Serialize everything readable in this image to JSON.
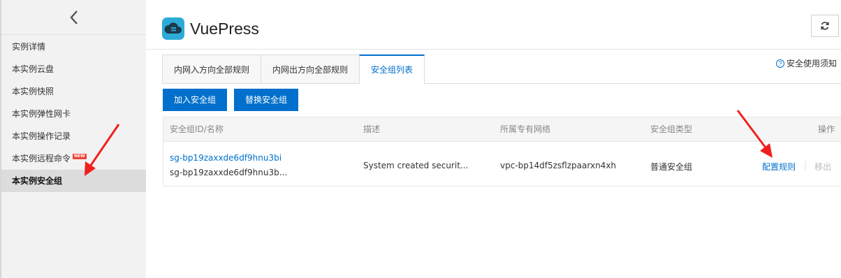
{
  "sidebar": {
    "items": [
      {
        "label": "实例详情"
      },
      {
        "label": "本实例云盘"
      },
      {
        "label": "本实例快照"
      },
      {
        "label": "本实例弹性网卡"
      },
      {
        "label": "本实例操作记录"
      },
      {
        "label": "本实例远程命令",
        "badge": "NEW"
      },
      {
        "label": "本实例安全组"
      }
    ]
  },
  "header": {
    "title": "VuePress"
  },
  "tabs": [
    {
      "label": "内网入方向全部规则"
    },
    {
      "label": "内网出方向全部规则"
    },
    {
      "label": "安全组列表"
    }
  ],
  "help": {
    "label": "安全使用须知"
  },
  "actions": {
    "join": "加入安全组",
    "replace": "替换安全组"
  },
  "table": {
    "columns": [
      "安全组ID/名称",
      "描述",
      "所属专有网络",
      "安全组类型",
      "操作"
    ],
    "rows": [
      {
        "id": "sg-bp19zaxxde6df9hnu3bi",
        "name": "sg-bp19zaxxde6df9hnu3b...",
        "description": "System created securit...",
        "vpc": "vpc-bp14df5zsflzpaarxn4xh",
        "type": "普通安全组",
        "op_config": "配置规则",
        "op_separator": "|",
        "op_remove": "移出"
      }
    ]
  },
  "colors": {
    "accent": "#0070cc",
    "brand": "#ff6a00",
    "annotation": "#f0201d"
  }
}
